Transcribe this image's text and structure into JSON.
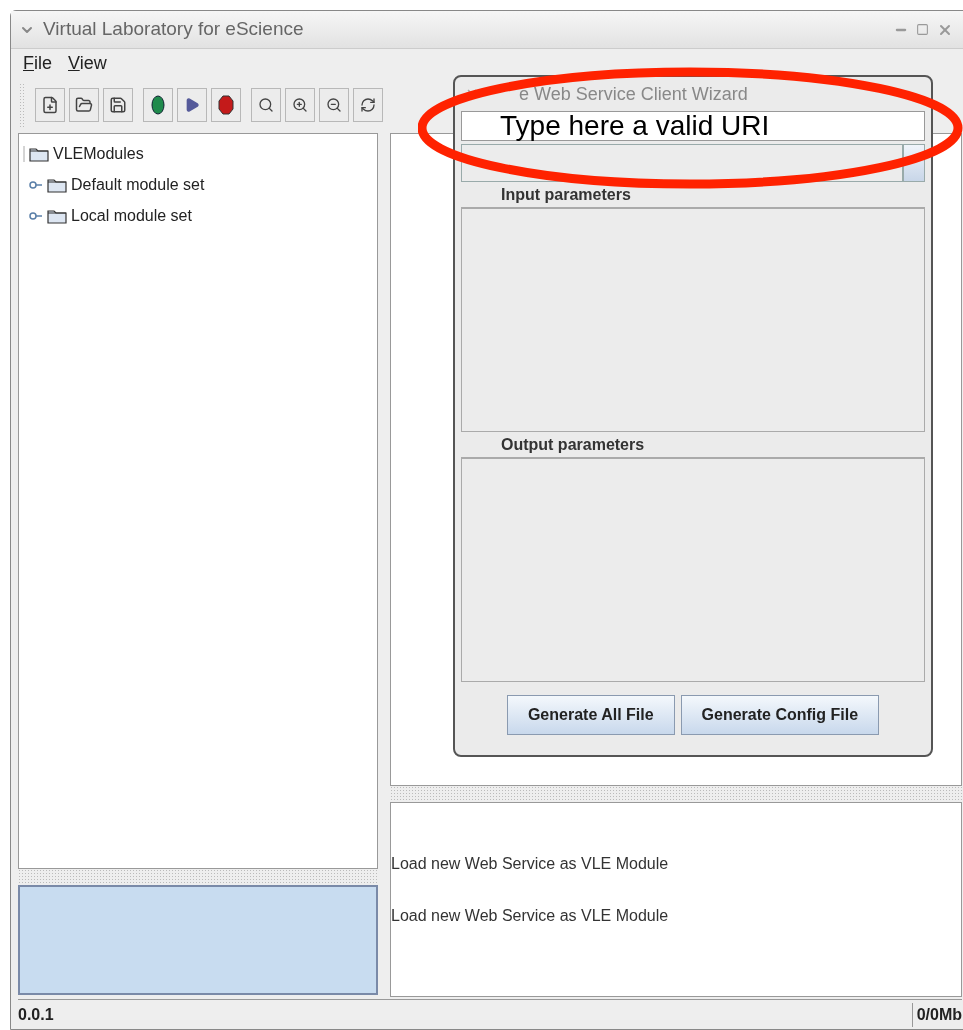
{
  "window": {
    "title": "Virtual Laboratory for eScience"
  },
  "menu": [
    {
      "label": "File"
    },
    {
      "label": "View"
    }
  ],
  "tree": {
    "label": "VLEModules",
    "expanded": true,
    "children": [
      {
        "label": "Default module set",
        "expanded": false
      },
      {
        "label": "Local module set",
        "expanded": false
      }
    ]
  },
  "log": [
    "Load new Web Service as VLE Module",
    "Load new Web Service as VLE Module"
  ],
  "status_bar": {
    "version": "0.0.1",
    "memory": "0/0Mb"
  },
  "wizard": {
    "title": "e Web Service Client Wizard",
    "uri_field": {
      "value": "Type here a valid URI"
    },
    "sections": [
      "Input parameters",
      "Output parameters"
    ],
    "buttons": [
      "Generate All File",
      "Generate Config File"
    ]
  }
}
